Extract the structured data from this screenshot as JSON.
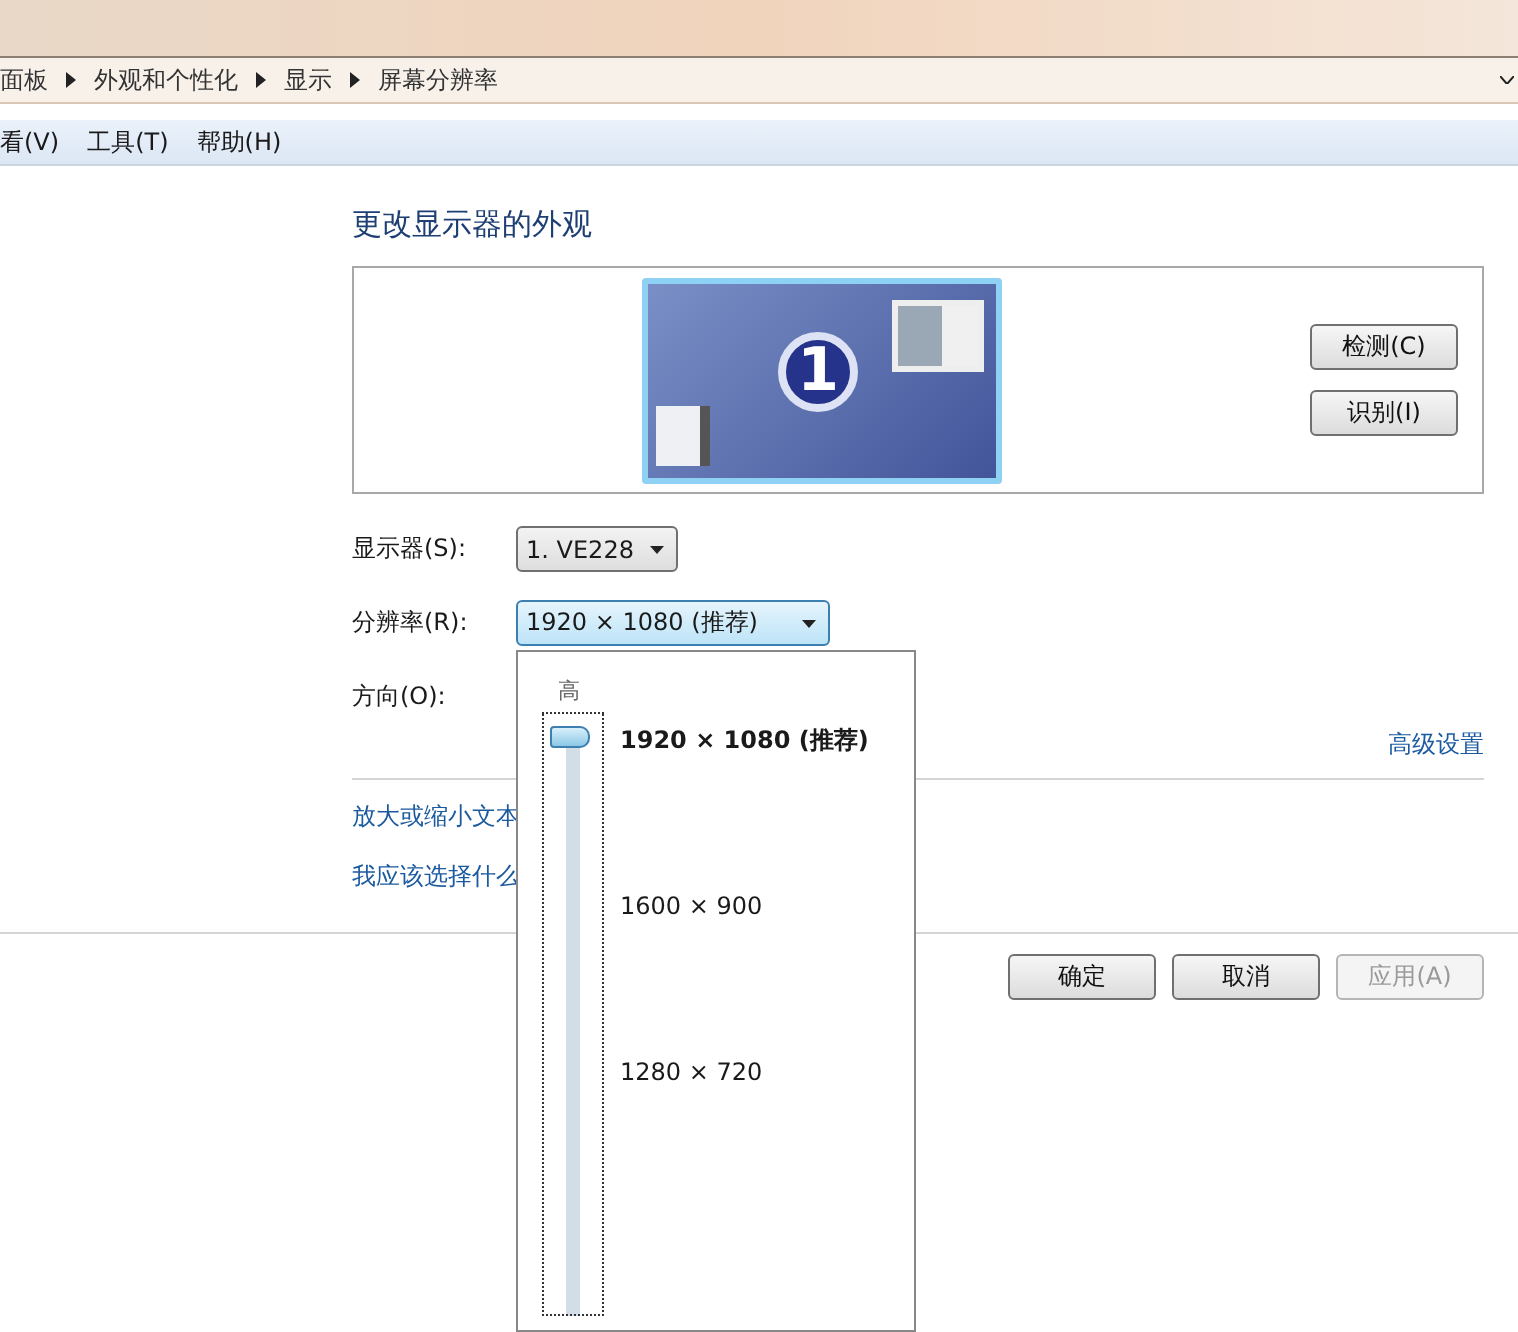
{
  "breadcrumb": [
    "面板",
    "外观和个性化",
    "显示",
    "屏幕分辨率"
  ],
  "menu": [
    "看(V)",
    "工具(T)",
    "帮助(H)"
  ],
  "title": "更改显示器的外观",
  "monitor_badge": "1",
  "side_buttons": [
    "检测(C)",
    "识别(I)"
  ],
  "fields": [
    {
      "label": "显示器(S):",
      "kind": "select",
      "value": "1. VE228",
      "open": false
    },
    {
      "label": "分辨率(R):",
      "kind": "select",
      "value": "1920 × 1080 (推荐)",
      "open": true
    },
    {
      "label": "方向(O):",
      "kind": "label"
    }
  ],
  "advanced_link": "高级设置",
  "links": [
    "放大或缩小文本",
    "我应该选择什么"
  ],
  "buttons": [
    {
      "label": "确定",
      "disabled": false
    },
    {
      "label": "取消",
      "disabled": false
    },
    {
      "label": "应用(A)",
      "disabled": true
    }
  ],
  "resolution_popup": {
    "high_label": "高",
    "level": 1,
    "options": [
      {
        "label": "1920 × 1080 (推荐)",
        "selected": true
      },
      {
        "label": "1600 × 900",
        "selected": false
      },
      {
        "label": "1280 × 720",
        "selected": false
      }
    ]
  }
}
